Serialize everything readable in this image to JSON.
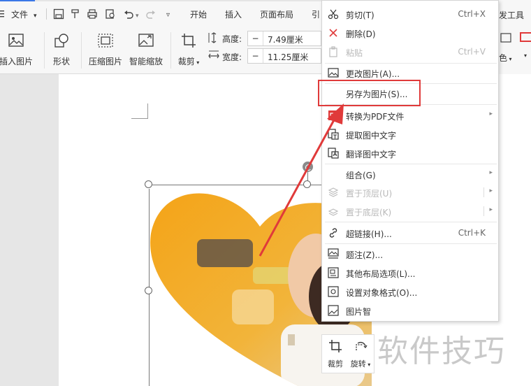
{
  "toolbar": {
    "file_menu": "文件",
    "tabs": [
      "开始",
      "插入",
      "页面布局",
      "引"
    ],
    "partial_tab_right": "发工具"
  },
  "ribbon": {
    "insert_picture": "插入图片",
    "shape": "形状",
    "compress_picture": "压缩图片",
    "smart_zoom": "智能缩放",
    "crop": "裁剪",
    "height_label": "高度:",
    "height_value": "7.49厘米",
    "width_label": "宽度:",
    "width_value": "11.25厘米",
    "color_partial": "色"
  },
  "context_menu": {
    "items": [
      {
        "label": "剪切(T)",
        "shortcut": "Ctrl+X",
        "icon": "scissors-icon",
        "disabled": false
      },
      {
        "label": "删除(D)",
        "shortcut": "",
        "icon": "delete-x-icon",
        "disabled": false
      },
      {
        "label": "粘贴",
        "shortcut": "Ctrl+V",
        "icon": "paste-icon",
        "disabled": true
      },
      {
        "label": "更改图片(A)...",
        "shortcut": "",
        "icon": "change-picture-icon",
        "disabled": false
      },
      {
        "label": "另存为图片(S)...",
        "shortcut": "",
        "icon": "",
        "disabled": false
      },
      {
        "label": "转换为PDF文件",
        "shortcut": "",
        "icon": "pdf-icon",
        "disabled": false,
        "submenu": true
      },
      {
        "label": "提取图中文字",
        "shortcut": "",
        "icon": "extract-text-icon",
        "disabled": false
      },
      {
        "label": "翻译图中文字",
        "shortcut": "",
        "icon": "translate-icon",
        "disabled": false
      },
      {
        "label": "组合(G)",
        "shortcut": "",
        "icon": "",
        "disabled": false,
        "submenu": true
      },
      {
        "label": "置于顶层(U)",
        "shortcut": "",
        "icon": "bring-front-icon",
        "disabled": true,
        "submenu": true
      },
      {
        "label": "置于底层(K)",
        "shortcut": "",
        "icon": "send-back-icon",
        "disabled": true,
        "submenu": true
      },
      {
        "label": "超链接(H)...",
        "shortcut": "Ctrl+K",
        "icon": "link-icon",
        "disabled": false
      },
      {
        "label": "题注(Z)...",
        "shortcut": "",
        "icon": "caption-icon",
        "disabled": false
      },
      {
        "label": "其他布局选项(L)...",
        "shortcut": "",
        "icon": "layout-options-icon",
        "disabled": false
      },
      {
        "label": "设置对象格式(O)...",
        "shortcut": "",
        "icon": "format-object-icon",
        "disabled": false
      },
      {
        "label": "图片智",
        "shortcut": "",
        "icon": "picture-smart-icon",
        "disabled": false
      }
    ]
  },
  "mini_toolbar": {
    "crop": "裁剪",
    "rotate": "旋转"
  },
  "watermark": "软件技巧",
  "colors": {
    "highlight": "#e03a3a",
    "arrow": "#e03a3a",
    "heart_orange": "#f2a21a"
  }
}
